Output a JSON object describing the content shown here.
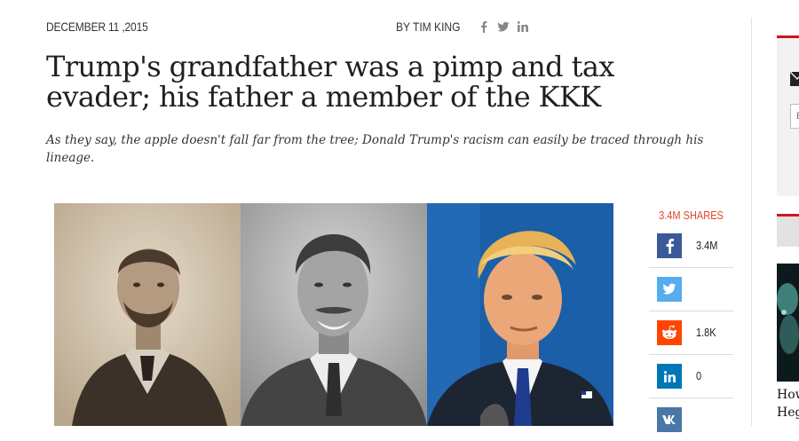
{
  "meta": {
    "date": "DECEMBER 11 ,2015",
    "byline": "BY TIM KING",
    "byline_social": [
      "facebook-icon",
      "twitter-icon",
      "linkedin-icon"
    ]
  },
  "article": {
    "title": "Trump's grandfather was a pimp and tax evader; his father a member of the KKK",
    "subtitle": "As they say, the apple doesn't fall far from the tree; Donald Trump's racism can easily be traced through his lineage."
  },
  "hero": {
    "panels": [
      "grandfather-photo",
      "father-photo",
      "donald-trump-photo"
    ]
  },
  "share": {
    "total": "3.4M SHARES",
    "buttons": [
      {
        "network": "facebook",
        "count": "3.4M",
        "color": "#3b5998"
      },
      {
        "network": "twitter",
        "count": "",
        "color": "#55acee"
      },
      {
        "network": "reddit",
        "count": "1.8K",
        "color": "#ff4500"
      },
      {
        "network": "linkedin",
        "count": "0",
        "color": "#0077b5"
      },
      {
        "network": "vk",
        "count": "",
        "color": "#4a76a8"
      }
    ]
  },
  "sidebar": {
    "email_placeholder": "E",
    "article_text_lines": [
      "How",
      "Heg"
    ]
  },
  "colors": {
    "accent": "#e0452e",
    "sidebar_red": "#d0161b"
  }
}
